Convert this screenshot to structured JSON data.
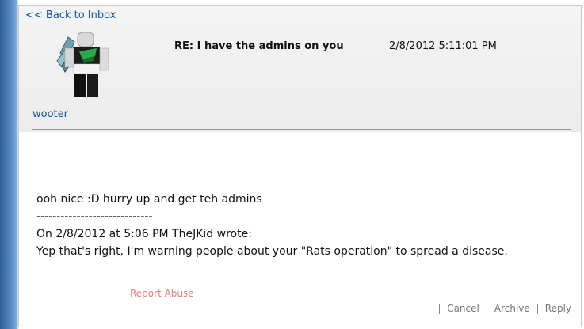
{
  "nav": {
    "back_label": "<< Back to Inbox"
  },
  "message": {
    "subject": "RE: I have the admins on you",
    "date": "2/8/2012 5:11:01 PM",
    "sender": "wooter",
    "body_lines": [
      "ooh nice :D hurry up and get teh admins",
      "-----------------------------",
      "On 2/8/2012 at 5:06 PM TheJKid wrote:",
      "Yep that's right, I'm warning people about your \"Rats operation\" to spread a disease."
    ]
  },
  "actions": {
    "report_abuse": "Report Abuse",
    "cancel": "Cancel",
    "archive": "Archive",
    "reply": "Reply"
  },
  "colors": {
    "link": "#0b55a6",
    "report_abuse": "#e08080",
    "action_text": "#777777"
  },
  "icons": {
    "avatar": "roblox-character-avatar"
  }
}
